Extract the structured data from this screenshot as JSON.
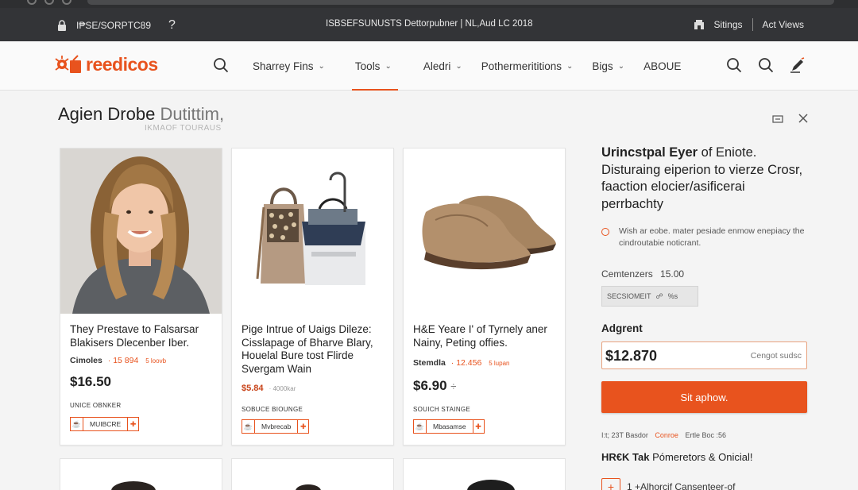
{
  "topbar": {
    "left_label": "I₱SE/SORPTC89",
    "help": "?",
    "center_text": "ISBSEFSUNUSTS Dettorpubner | NL,Aud LC 2018",
    "sittings": "Sitings",
    "act_views": "Act Views"
  },
  "brand": {
    "name": "reedicos",
    "accent": "#e8531e"
  },
  "nav": {
    "items": [
      {
        "label": "Sharrey Fins",
        "chevron": true
      },
      {
        "label": "Tools",
        "chevron": true,
        "active": true
      },
      {
        "label": "Aledri",
        "chevron": true
      },
      {
        "label": "Pothermerititions",
        "chevron": true
      },
      {
        "label": "Bigs",
        "chevron": true
      },
      {
        "label": "ABOUE",
        "chevron": false
      }
    ]
  },
  "page": {
    "title_dark": "Agien Drobe",
    "title_light": "Dutittim,",
    "subtitle": "IKMAOF TOURAUS"
  },
  "products": [
    {
      "title": "They Prestave to Falsarsar Blakisers Dlecenber Iber.",
      "meta_label": "Cimoles",
      "meta_value": "· 15 894",
      "meta_tag": "5 loovb",
      "price": "$16.50",
      "options": "UNICE  OBNKER",
      "btn_label": "MUIBCRE"
    },
    {
      "title": "Pige Intrue of Uaigs Dileze: Cisslapage of Bharve Blary, Houelal Bure tost Flirde Svergam Wain",
      "price": "$5.84",
      "price_sub": "· 4000kar",
      "options": "SOBUCE  BIOUNGE",
      "btn_label": "Mvbrecab"
    },
    {
      "title": "H&E Yeare I' of Tyrnely aner Nainy, Peting offies.",
      "meta_label": "Stemdla",
      "meta_value": "· 12.456",
      "meta_tag": "5 lupan",
      "price": "$6.90",
      "price_symbol": "÷",
      "options": "SOUICH  STAINGE",
      "btn_label": "Mbasamse"
    }
  ],
  "panel": {
    "heading_bold": "Urincstpal Eyer",
    "heading_rest": " of Eniote. Disturaing eiperion to vierze Crosr, faaction elocier/asificerai perrbachty",
    "note": "Wish ar eobe. mater pesiade enmow enepiacy the cindroutabie noticrant.",
    "size_label": "Cemtenzers",
    "size_value": "15.00",
    "chip_text": "SECSIOMEIT",
    "chip_extra": "%s",
    "amount_label": "Adgrent",
    "amount_value": "$12.870",
    "amount_hint": "Cengot sudsc",
    "cta": "Sit aphow.",
    "tiny_left": "I:t; 23T Basdor",
    "tiny_mid": "Conroe",
    "tiny_right": "Ertle Boc :56",
    "sub_bold": "HR€K Tak",
    "sub_rest": " Pómeretors & Onicial!",
    "row_text": "1 +Alhorcif Cansenteer-of"
  }
}
